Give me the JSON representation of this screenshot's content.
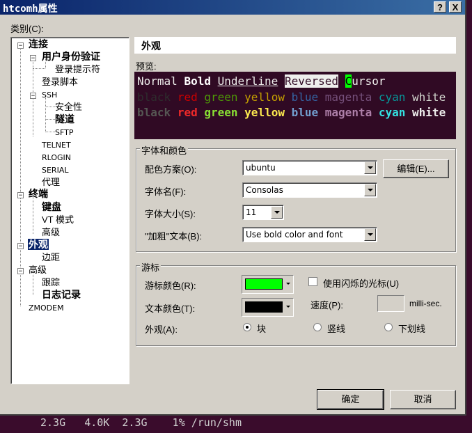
{
  "window": {
    "title": "htcomh属性",
    "help_btn": "?",
    "close_btn": "X"
  },
  "category_label": "类别(C):",
  "tree": {
    "items": [
      {
        "label": "连接",
        "bold": true
      },
      {
        "label": "用户身份验证",
        "bold": true
      },
      {
        "label": "登录提示符"
      },
      {
        "label": "登录脚本"
      },
      {
        "label": "SSH"
      },
      {
        "label": "安全性"
      },
      {
        "label": "隧道",
        "bold": true
      },
      {
        "label": "SFTP"
      },
      {
        "label": "TELNET"
      },
      {
        "label": "RLOGIN"
      },
      {
        "label": "SERIAL"
      },
      {
        "label": "代理"
      },
      {
        "label": "终端",
        "bold": true
      },
      {
        "label": "键盘",
        "bold": true
      },
      {
        "label": "VT 模式"
      },
      {
        "label": "高级"
      },
      {
        "label": "外观",
        "bold": true,
        "selected": true
      },
      {
        "label": "边距"
      },
      {
        "label": "高级"
      },
      {
        "label": "跟踪"
      },
      {
        "label": "日志记录",
        "bold": true
      },
      {
        "label": "ZMODEM"
      }
    ]
  },
  "header": {
    "title": "外观"
  },
  "preview": {
    "label": "预览:",
    "line1": {
      "normal": "Normal",
      "bold": "Bold",
      "underline": "Underline",
      "reversed": "Reversed",
      "cursor_char": "C",
      "cursor_rest": "ursor"
    },
    "colors": [
      {
        "name": "black",
        "color": "#2e2e2e",
        "bright": "#555753"
      },
      {
        "name": "red",
        "color": "#cc0000",
        "bright": "#ef2929"
      },
      {
        "name": "green",
        "color": "#4e9a06",
        "bright": "#8ae234"
      },
      {
        "name": "yellow",
        "color": "#c4a000",
        "bright": "#fce94f"
      },
      {
        "name": "blue",
        "color": "#3465a4",
        "bright": "#729fcf"
      },
      {
        "name": "magenta",
        "color": "#75507b",
        "bright": "#ad7fa8"
      },
      {
        "name": "cyan",
        "color": "#06989a",
        "bright": "#34e2e2"
      },
      {
        "name": "white",
        "color": "#d3d7cf",
        "bright": "#eeeeec"
      }
    ]
  },
  "font_group": {
    "legend": "字体和颜色",
    "scheme_label": "配色方案(O):",
    "scheme_value": "ubuntu",
    "edit_button": "编辑(E)...",
    "font_label": "字体名(F):",
    "font_value": "Consolas",
    "size_label": "字体大小(S):",
    "size_value": "11",
    "bold_label": "\"加粗\"文本(B):",
    "bold_value": "Use bold color and font"
  },
  "cursor_group": {
    "legend": "游标",
    "cursor_color_label": "游标颜色(R):",
    "cursor_color": "#00ff00",
    "text_color_label": "文本颜色(T):",
    "text_color": "#000000",
    "blink_label": "使用闪烁的光标(U)",
    "blink_checked": false,
    "speed_label": "速度(P):",
    "speed_value": "",
    "speed_unit": "milli-sec.",
    "appearance_label": "外观(A):",
    "options": [
      {
        "label": "块",
        "selected": true
      },
      {
        "label": "竖线",
        "selected": false
      },
      {
        "label": "下划线",
        "selected": false
      }
    ]
  },
  "footer": {
    "ok": "确定",
    "cancel": "取消"
  },
  "background_terminal": "2.3G   4.0K  2.3G    1% /run/shm"
}
